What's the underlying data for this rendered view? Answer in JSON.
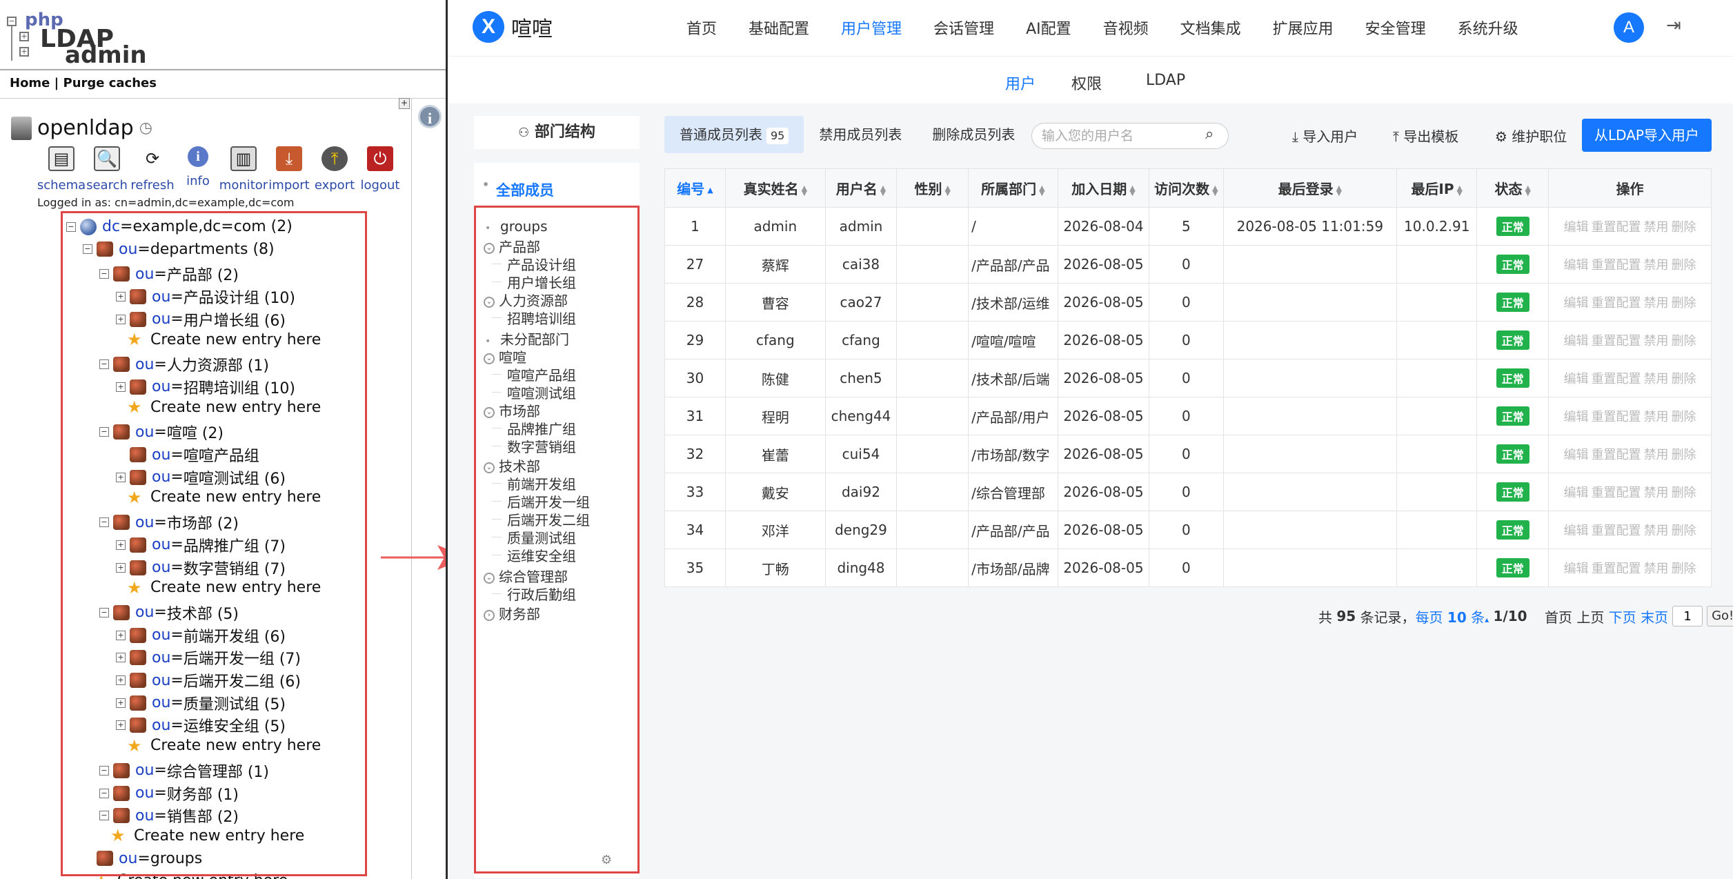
{
  "ldap": {
    "logo": {
      "php": "php",
      "ldap": "LDAP",
      "admin": "admin"
    },
    "breadcrumb": "Home | Purge caches",
    "server_name": "openldap",
    "toolbar": [
      "schema",
      "search",
      "refresh",
      "info",
      "monitor",
      "import",
      "export",
      "logout"
    ],
    "logged_in": "Logged in as: cn=admin,dc=example,dc=com",
    "tree": [
      {
        "key": "dc",
        "val": "example",
        "rest": ",dc=com (2)",
        "type": "root"
      },
      {
        "key": "ou",
        "val": "departments (8)",
        "type": "node"
      },
      {
        "key": "ou",
        "val": "产品部 (2)",
        "type": "node"
      },
      {
        "key": "ou",
        "val": "产品设计组 (10)",
        "type": "node"
      },
      {
        "key": "ou",
        "val": "用户增长组 (6)",
        "type": "node"
      },
      {
        "text": "Create new entry here",
        "type": "new"
      },
      {
        "key": "ou",
        "val": "人力资源部 (1)",
        "type": "node"
      },
      {
        "key": "ou",
        "val": "招聘培训组 (10)",
        "type": "node"
      },
      {
        "text": "Create new entry here",
        "type": "new"
      },
      {
        "key": "ou",
        "val": "喧喧 (2)",
        "type": "node"
      },
      {
        "key": "ou",
        "val": "喧喧产品组",
        "type": "node"
      },
      {
        "key": "ou",
        "val": "喧喧测试组 (6)",
        "type": "node"
      },
      {
        "text": "Create new entry here",
        "type": "new"
      },
      {
        "key": "ou",
        "val": "市场部 (2)",
        "type": "node"
      },
      {
        "key": "ou",
        "val": "品牌推广组 (7)",
        "type": "node"
      },
      {
        "key": "ou",
        "val": "数字营销组 (7)",
        "type": "node"
      },
      {
        "text": "Create new entry here",
        "type": "new"
      },
      {
        "key": "ou",
        "val": "技术部 (5)",
        "type": "node"
      },
      {
        "key": "ou",
        "val": "前端开发组 (6)",
        "type": "node"
      },
      {
        "key": "ou",
        "val": "后端开发一组 (7)",
        "type": "node"
      },
      {
        "key": "ou",
        "val": "后端开发二组 (6)",
        "type": "node"
      },
      {
        "key": "ou",
        "val": "质量测试组 (5)",
        "type": "node"
      },
      {
        "key": "ou",
        "val": "运维安全组 (5)",
        "type": "node"
      },
      {
        "text": "Create new entry here",
        "type": "new"
      },
      {
        "key": "ou",
        "val": "综合管理部 (1)",
        "type": "node"
      },
      {
        "key": "ou",
        "val": "财务部 (1)",
        "type": "node"
      },
      {
        "key": "ou",
        "val": "销售部 (2)",
        "type": "node"
      },
      {
        "text": "Create new entry here",
        "type": "new"
      },
      {
        "key": "ou",
        "val": "groups",
        "type": "node"
      },
      {
        "text": "Create new entry here",
        "type": "new"
      }
    ]
  },
  "app": {
    "brand": "喧喧",
    "brand_logo": "X",
    "nav": [
      "首页",
      "基础配置",
      "用户管理",
      "会话管理",
      "AI配置",
      "音视频",
      "文档集成",
      "扩展应用",
      "安全管理",
      "系统升级"
    ],
    "nav_active": "用户管理",
    "avatar": "A",
    "subnav": [
      "用户",
      "权限",
      "LDAP"
    ],
    "subnav_active": "用户",
    "dept_title": "部门结构",
    "dept_all": "全部成员",
    "depts": [
      {
        "label": "groups",
        "type": "dot"
      },
      {
        "label": "产品部",
        "type": "parent"
      },
      {
        "label": "产品设计组",
        "type": "child"
      },
      {
        "label": "用户增长组",
        "type": "child"
      },
      {
        "label": "人力资源部",
        "type": "parent"
      },
      {
        "label": "招聘培训组",
        "type": "child"
      },
      {
        "label": "未分配部门",
        "type": "dot"
      },
      {
        "label": "喧喧",
        "type": "parent"
      },
      {
        "label": "喧喧产品组",
        "type": "child"
      },
      {
        "label": "喧喧测试组",
        "type": "child"
      },
      {
        "label": "市场部",
        "type": "parent"
      },
      {
        "label": "品牌推广组",
        "type": "child"
      },
      {
        "label": "数字营销组",
        "type": "child"
      },
      {
        "label": "技术部",
        "type": "parent"
      },
      {
        "label": "前端开发组",
        "type": "child"
      },
      {
        "label": "后端开发一组",
        "type": "child"
      },
      {
        "label": "后端开发二组",
        "type": "child"
      },
      {
        "label": "质量测试组",
        "type": "child"
      },
      {
        "label": "运维安全组",
        "type": "child"
      },
      {
        "label": "综合管理部",
        "type": "parent"
      },
      {
        "label": "行政后勤组",
        "type": "child"
      },
      {
        "label": "财务部",
        "type": "collapsed"
      }
    ],
    "tabs": [
      {
        "label": "普通成员列表",
        "count": "95"
      },
      {
        "label": "禁用成员列表"
      },
      {
        "label": "删除成员列表"
      }
    ],
    "search_placeholder": "输入您的用户名",
    "actions": [
      "导入用户",
      "导出模板",
      "维护职位"
    ],
    "ldap_import": "从LDAP导入用户",
    "columns": [
      "编号",
      "真实姓名",
      "用户名",
      "性别",
      "所属部门",
      "加入日期",
      "访问次数",
      "最后登录",
      "最后IP",
      "状态",
      "操作"
    ],
    "rows": [
      [
        "1",
        "admin",
        "admin",
        "",
        "/",
        "2026-08-04",
        "5",
        "2026-08-05 11:01:59",
        "10.0.2.91",
        "正常"
      ],
      [
        "27",
        "蔡辉",
        "cai38",
        "",
        "/产品部/产品",
        "2026-08-05",
        "0",
        "",
        "",
        "正常"
      ],
      [
        "28",
        "曹容",
        "cao27",
        "",
        "/技术部/运维",
        "2026-08-05",
        "0",
        "",
        "",
        "正常"
      ],
      [
        "29",
        "cfang",
        "cfang",
        "",
        "/喧喧/喧喧",
        "2026-08-05",
        "0",
        "",
        "",
        "正常"
      ],
      [
        "30",
        "陈健",
        "chen5",
        "",
        "/技术部/后端",
        "2026-08-05",
        "0",
        "",
        "",
        "正常"
      ],
      [
        "31",
        "程明",
        "cheng44",
        "",
        "/产品部/用户",
        "2026-08-05",
        "0",
        "",
        "",
        "正常"
      ],
      [
        "32",
        "崔蕾",
        "cui54",
        "",
        "/市场部/数字",
        "2026-08-05",
        "0",
        "",
        "",
        "正常"
      ],
      [
        "33",
        "戴安",
        "dai92",
        "",
        "/综合管理部",
        "2026-08-05",
        "0",
        "",
        "",
        "正常"
      ],
      [
        "34",
        "邓洋",
        "deng29",
        "",
        "/产品部/产品",
        "2026-08-05",
        "0",
        "",
        "",
        "正常"
      ],
      [
        "35",
        "丁畅",
        "ding48",
        "",
        "/市场部/品牌",
        "2026-08-05",
        "0",
        "",
        "",
        "正常"
      ]
    ],
    "ops": [
      "编辑",
      "重置配置",
      "禁用",
      "删除"
    ],
    "pager": {
      "prefix": "共",
      "total": "95",
      "records": "条记录，",
      "per_page_label": "每页",
      "per_page": "10",
      "per_page_unit": "条",
      "page": "1/10",
      "first": "首页",
      "prev": "上页",
      "next": "下页",
      "last": "末页",
      "input": "1",
      "go": "Go!"
    },
    "colors": {
      "primary": "#1677ff",
      "ok": "#21b24b",
      "highlight": "#e04545"
    }
  }
}
